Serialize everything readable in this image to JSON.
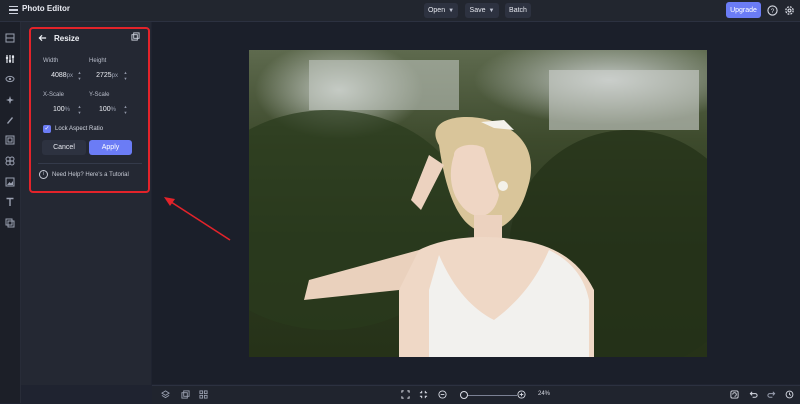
{
  "app": {
    "title": "Photo Editor"
  },
  "header": {
    "menus": [
      {
        "label": "Open",
        "has_dropdown": true
      },
      {
        "label": "Save",
        "has_dropdown": true
      },
      {
        "label": "Batch",
        "has_dropdown": false
      }
    ],
    "upgrade_label": "Upgrade",
    "icons": [
      "help-icon",
      "settings-icon"
    ]
  },
  "sidebar_tools": [
    "crop-icon",
    "adjust-icon",
    "eye-icon",
    "effects-icon",
    "brush-icon",
    "frame-icon",
    "overlay-icon",
    "image-icon",
    "text-icon",
    "layers-icon"
  ],
  "resize_panel": {
    "title": "Resize",
    "width_label": "Width",
    "width_value": "4088",
    "width_unit": "px",
    "height_label": "Height",
    "height_value": "2725",
    "height_unit": "px",
    "xscale_label": "X-Scale",
    "xscale_value": "100",
    "xscale_unit": "%",
    "yscale_label": "Y-Scale",
    "yscale_value": "100",
    "yscale_unit": "%",
    "lock_label": "Lock Aspect Ratio",
    "lock_checked": true,
    "cancel_label": "Cancel",
    "apply_label": "Apply",
    "help_text": "Need Help? Here's a Tutorial"
  },
  "footer": {
    "zoom_level": "24%",
    "zoom_fraction": 0.1
  },
  "colors": {
    "accent": "#6b7cf5",
    "highlight": "#e3232a",
    "background": "#1f2330"
  }
}
